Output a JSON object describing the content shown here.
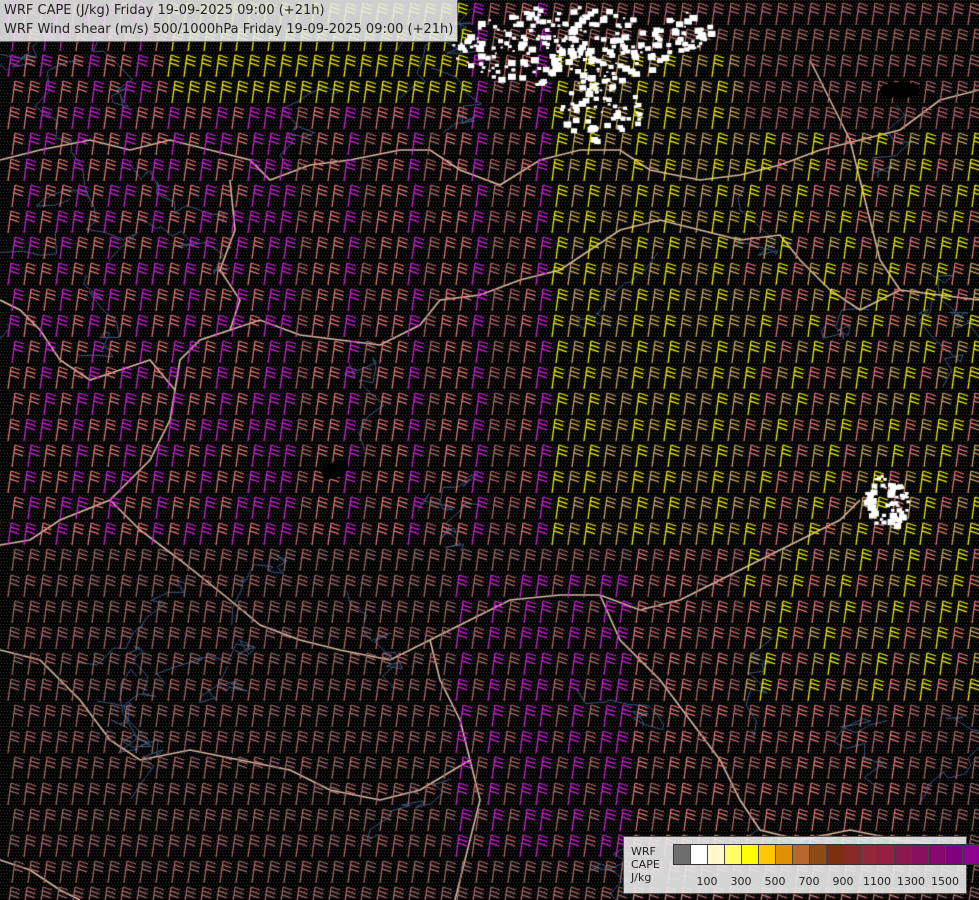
{
  "title": {
    "line1": "WRF CAPE (J/kg) Friday 19-09-2025 09:00 (+21h)",
    "line2": "WRF Wind shear (m/s) 500/1000hPa Friday 19-09-2025 09:00 (+21h)"
  },
  "legend": {
    "model": "WRF",
    "variable": "CAPE",
    "unit": "J/kg",
    "colors": [
      "#6e6e6e",
      "#ffffff",
      "#fffacd",
      "#ffff66",
      "#ffff00",
      "#ffc800",
      "#e09000",
      "#b8682a",
      "#8c4a14",
      "#7a3010",
      "#8a2a28",
      "#902838",
      "#942044",
      "#8c1850",
      "#881060",
      "#880870",
      "#800080",
      "#900090"
    ],
    "tick_labels": [
      "100",
      "300",
      "500",
      "700",
      "900",
      "1100",
      "1300",
      "1500"
    ]
  },
  "map": {
    "background": "#000000",
    "stipple_color": "#3c3c3c",
    "border_color": "#d8b8a0",
    "river_color": "#3a5a80",
    "barb_colors": {
      "magenta": "#d020d8",
      "salmon": "#e07878",
      "rose": "#b06868",
      "dusky": "#9a6a6a",
      "yellow": "#f0f000",
      "khaki": "#c8a860"
    },
    "cape_patch_color": "#ffffff"
  }
}
